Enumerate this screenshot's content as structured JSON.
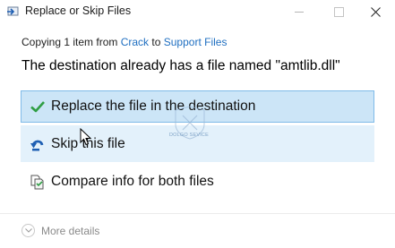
{
  "window": {
    "title": "Replace or Skip Files"
  },
  "copy_info": {
    "prefix": "Copying 1 item from ",
    "source": "Crack",
    "middle": " to ",
    "destination": "Support Files"
  },
  "heading": "The destination already has a file named \"amtlib.dll\"",
  "options": [
    {
      "label": "Replace the file in the destination",
      "icon": "checkmark-icon",
      "state": "selected"
    },
    {
      "label": "Skip this file",
      "icon": "skip-arrow-icon",
      "state": "hover"
    },
    {
      "label": "Compare info for both files",
      "icon": "compare-files-icon",
      "state": "normal"
    }
  ],
  "footer": {
    "more_details_label": "More details",
    "icon": "chevron-down-icon"
  },
  "watermark": {
    "text": "DOLGO SEVICE"
  },
  "colors": {
    "link": "#1f6fc1",
    "selected_bg": "#cce5f7",
    "selected_border": "#7fbbe8",
    "hover_bg": "#e3f1fb",
    "check_green": "#2f9e44",
    "skip_blue": "#1e5fb3"
  }
}
